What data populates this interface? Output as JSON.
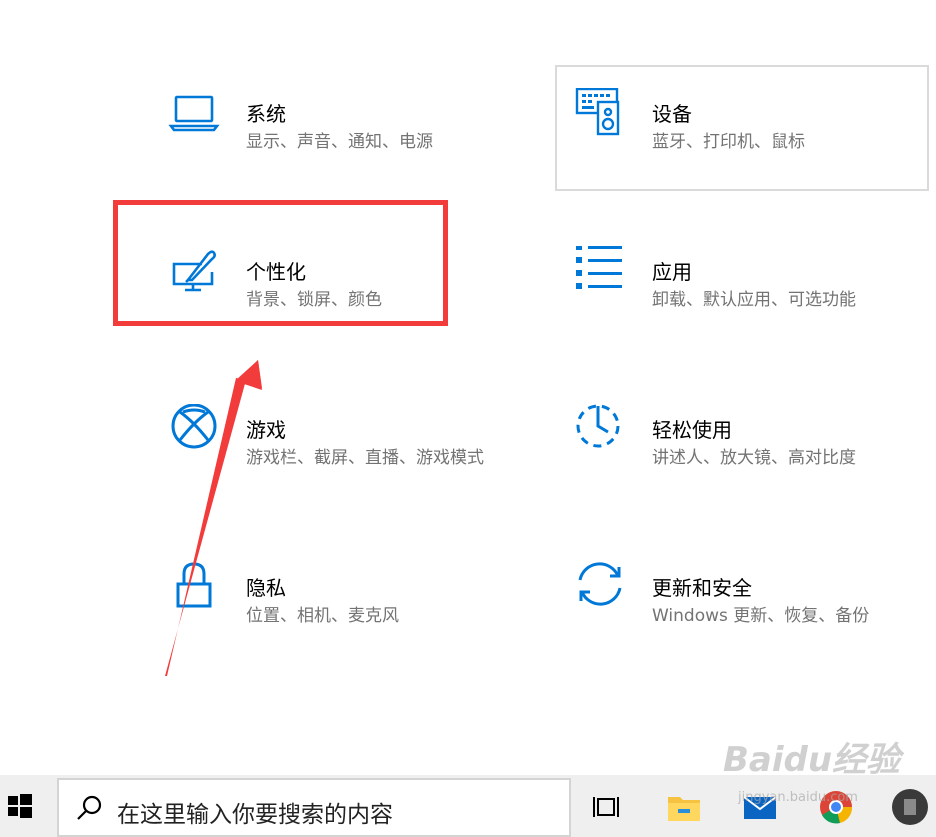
{
  "accent_color": "#0078d7",
  "highlight_color": "#f23c3c",
  "tiles": [
    {
      "key": "system",
      "title": "系统",
      "desc": "显示、声音、通知、电源",
      "icon": "laptop-icon"
    },
    {
      "key": "devices",
      "title": "设备",
      "desc": "蓝牙、打印机、鼠标",
      "icon": "keyboard-speaker-icon"
    },
    {
      "key": "personalization",
      "title": "个性化",
      "desc": "背景、锁屏、颜色",
      "icon": "paintbrush-monitor-icon"
    },
    {
      "key": "apps",
      "title": "应用",
      "desc": "卸载、默认应用、可选功能",
      "icon": "list-icon"
    },
    {
      "key": "gaming",
      "title": "游戏",
      "desc": "游戏栏、截屏、直播、游戏模式",
      "icon": "xbox-icon"
    },
    {
      "key": "ease_of_access",
      "title": "轻松使用",
      "desc": "讲述人、放大镜、高对比度",
      "icon": "ease-of-access-icon"
    },
    {
      "key": "privacy",
      "title": "隐私",
      "desc": "位置、相机、麦克风",
      "icon": "lock-icon"
    },
    {
      "key": "update",
      "title": "更新和安全",
      "desc": "Windows 更新、恢复、备份",
      "icon": "sync-icon"
    }
  ],
  "taskbar": {
    "search_placeholder": "在这里输入你要搜索的内容",
    "icons": [
      "windows-start-icon",
      "search-icon",
      "task-view-icon",
      "file-explorer-icon",
      "mail-icon",
      "chrome-icon",
      "app-icon"
    ]
  },
  "watermark": {
    "text": "Baidu经验",
    "sub": "jingyan.baidu.com"
  }
}
